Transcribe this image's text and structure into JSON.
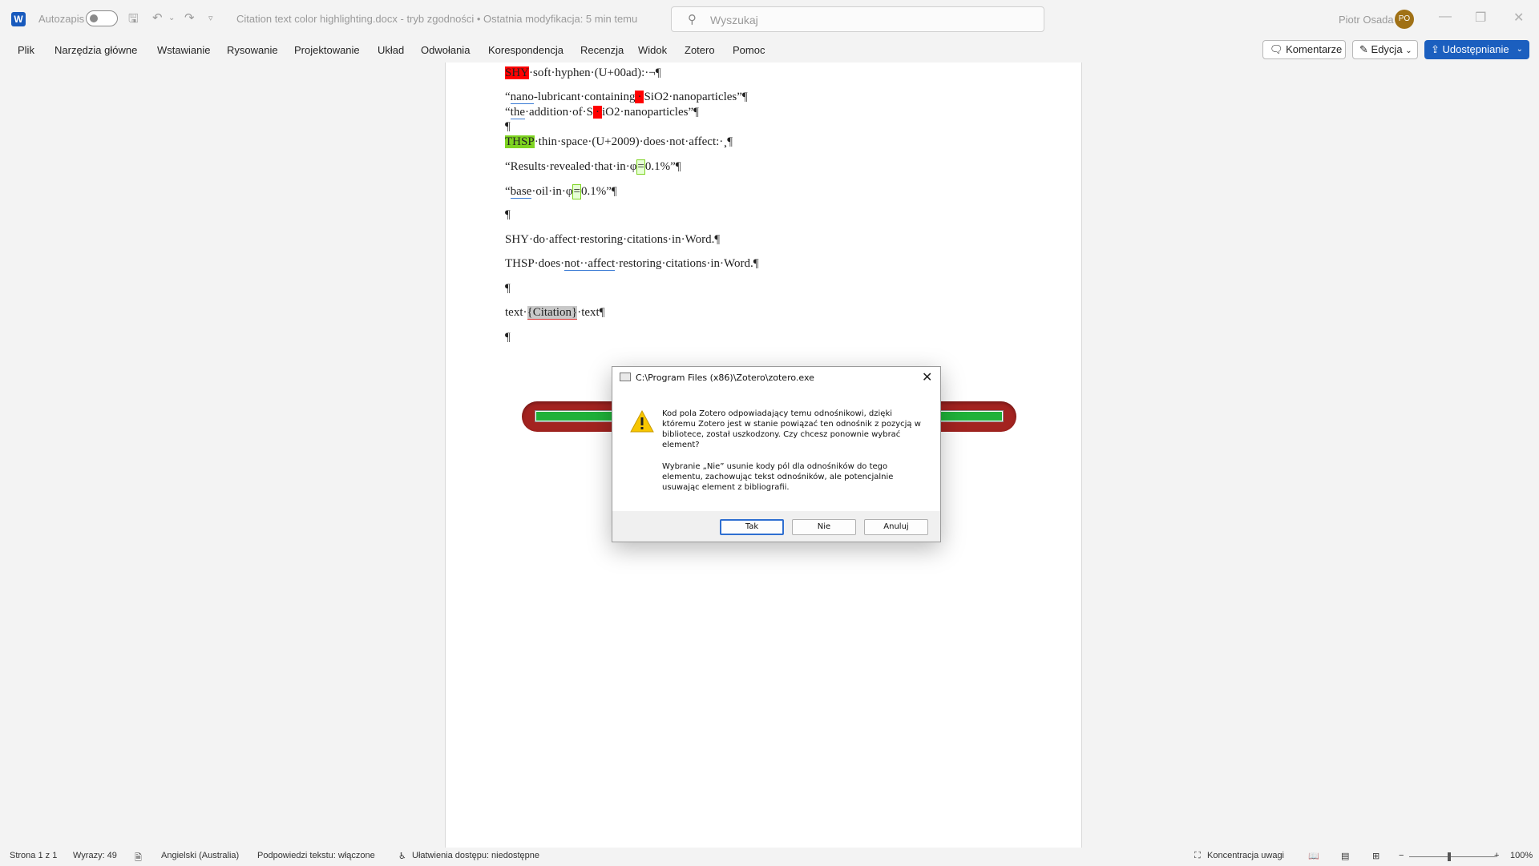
{
  "titlebar": {
    "autosave_label": "Autozapis",
    "document_title": "Citation text color highlighting.docx  -  tryb zgodności  •  Ostatnia modyfikacja: 5 min temu",
    "search_placeholder": "Wyszukaj",
    "user_name": "Piotr Osada",
    "user_initials": "PO"
  },
  "menu": {
    "items": [
      "Plik",
      "Narzędzia główne",
      "Wstawianie",
      "Rysowanie",
      "Projektowanie",
      "Układ",
      "Odwołania",
      "Korespondencja",
      "Recenzja",
      "Widok",
      "Zotero",
      "Pomoc"
    ],
    "comments_label": "Komentarze",
    "editing_label": "Edycja",
    "share_label": "Udostępnianie"
  },
  "document": {
    "l1_hl": "SHY",
    "l1_rest": "·soft·hyphen·(U+00ad):·¬¶",
    "l2_a": "“",
    "l2_b": "nano",
    "l2_c": "-lubricant·containing",
    "l2_d": "·",
    "l2_e": "SiO2·nanoparticles”¶",
    "l3_a": "“",
    "l3_b": "the",
    "l3_c": "·addition·of·S",
    "l3_d": "·",
    "l3_e": "iO2·nanoparticles”¶",
    "l4": "¶",
    "l5_hl": "THSP",
    "l5_rest": "·thin·space·(U+2009)·does·not·affect:·¸¶",
    "l6_a": "“Results·revealed·that·in·φ",
    "l6_b": "=",
    "l6_c": "0.1%”¶",
    "l7_a": "“",
    "l7_b": "base",
    "l7_c": "·oil·in·φ",
    "l7_d": "=",
    "l7_e": "0.1%”¶",
    "l8": "¶",
    "l9": "SHY·do·affect·restoring·citations·in·Word.¶",
    "l10_a": "THSP·does·",
    "l10_b": "not··affect",
    "l10_c": "·restoring·citations·in·Word.¶",
    "l11": "¶",
    "l12_a": "text·",
    "l12_b": "{Citation}",
    "l12_c": "·text¶",
    "l13": "¶"
  },
  "progress": {
    "value": 1.0
  },
  "dialog": {
    "title": "C:\\Program Files (x86)\\Zotero\\zotero.exe",
    "message1": "Kod pola Zotero odpowiadający temu odnośnikowi, dzięki któremu Zotero jest w stanie powiązać ten odnośnik z pozycją w bibliotece, został uszkodzony. Czy chcesz ponownie wybrać element?",
    "message2": "Wybranie „Nie” usunie kody pól dla odnośników do tego elementu, zachowując tekst odnośników, ale potencjalnie usuwając element z bibliografii.",
    "yes_label": "Tak",
    "no_label": "Nie",
    "cancel_label": "Anuluj"
  },
  "statusbar": {
    "page": "Strona 1 z 1",
    "words": "Wyrazy: 49",
    "language": "Angielski (Australia)",
    "predictions": "Podpowiedzi tekstu: włączone",
    "accessibility": "Ułatwienia dostępu: niedostępne",
    "focus": "Koncentracja uwagi",
    "zoom": "100%"
  },
  "colors": {
    "accent": "#1b5fbf",
    "highlight_red": "#ff0000",
    "highlight_green": "#7ed321",
    "progress_green": "#1fb139",
    "progress_track": "#a32320"
  }
}
